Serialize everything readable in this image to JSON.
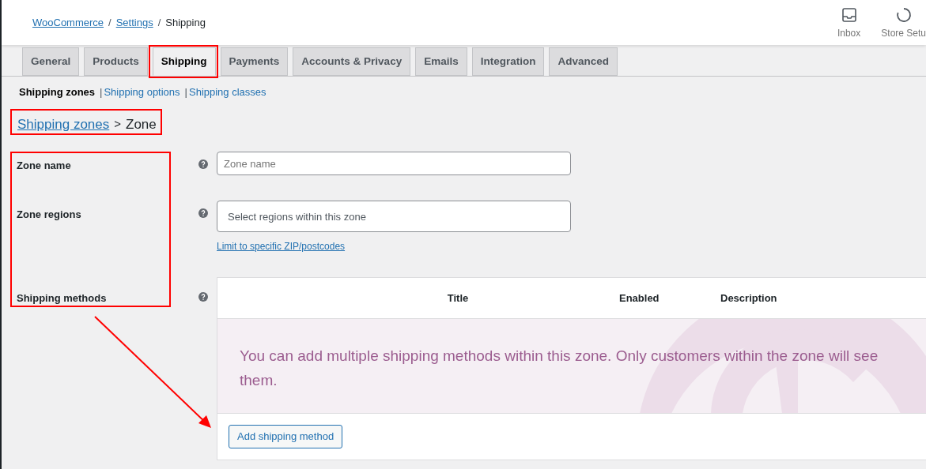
{
  "breadcrumbs": [
    {
      "label": "WooCommerce",
      "kind": "link"
    },
    {
      "label": "Settings",
      "kind": "link"
    },
    {
      "label": "Shipping",
      "kind": "current"
    }
  ],
  "breadcrumb_separator": "/",
  "subnav_separator": "|",
  "header_actions": [
    {
      "label": "Inbox",
      "kind": "inbox"
    },
    {
      "label": "Store Setu",
      "kind": "progress"
    }
  ],
  "tabs": [
    {
      "label": "General",
      "selected": false
    },
    {
      "label": "Products",
      "selected": false
    },
    {
      "label": "Shipping",
      "selected": true
    },
    {
      "label": "Payments",
      "selected": false
    },
    {
      "label": "Accounts & Privacy",
      "selected": false
    },
    {
      "label": "Emails",
      "selected": false
    },
    {
      "label": "Integration",
      "selected": false
    },
    {
      "label": "Advanced",
      "selected": false
    }
  ],
  "subnav": [
    {
      "label": "Shipping zones",
      "selected": true
    },
    {
      "label": "Shipping options",
      "selected": false
    },
    {
      "label": "Shipping classes",
      "selected": false
    }
  ],
  "heading": {
    "link": "Shipping zones",
    "separator": ">",
    "current": "Zone"
  },
  "form": {
    "zone_name": {
      "label": "Zone name",
      "placeholder": "Zone name"
    },
    "zone_regions": {
      "label": "Zone regions",
      "placeholder": "Select regions within this zone",
      "link": "Limit to specific ZIP/postcodes"
    },
    "shipping_methods": {
      "label": "Shipping methods",
      "columns": [
        "Title",
        "Enabled",
        "Description"
      ],
      "empty_message": "You can add multiple shipping methods within this zone. Only customers within the zone will see them.",
      "button": "Add shipping method"
    }
  }
}
